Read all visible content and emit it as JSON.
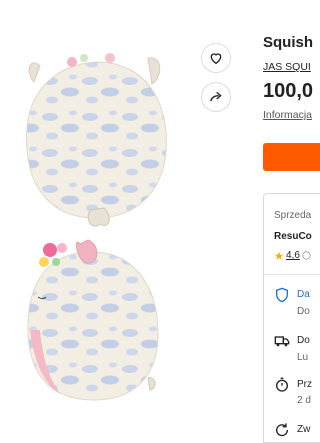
{
  "product": {
    "title": "Squish",
    "brand": "JAS SQUI",
    "price": "100,0",
    "info_link": "Informacja",
    "accent_color": "#ff5a00"
  },
  "actions": {
    "favorite_icon": "heart-icon",
    "share_icon": "share-arrow-icon"
  },
  "seller": {
    "label": "Sprzeda",
    "name": "ResuCo",
    "rating": "4,6"
  },
  "features": [
    {
      "icon": "shield-icon",
      "title": "Da",
      "subtitle": "Do"
    },
    {
      "icon": "truck-icon",
      "title": "Do",
      "subtitle": "Lu"
    },
    {
      "icon": "stopwatch-icon",
      "title": "Prz",
      "subtitle": "2 d"
    },
    {
      "icon": "return-arrow-icon",
      "title": "Zw",
      "subtitle": ""
    }
  ]
}
